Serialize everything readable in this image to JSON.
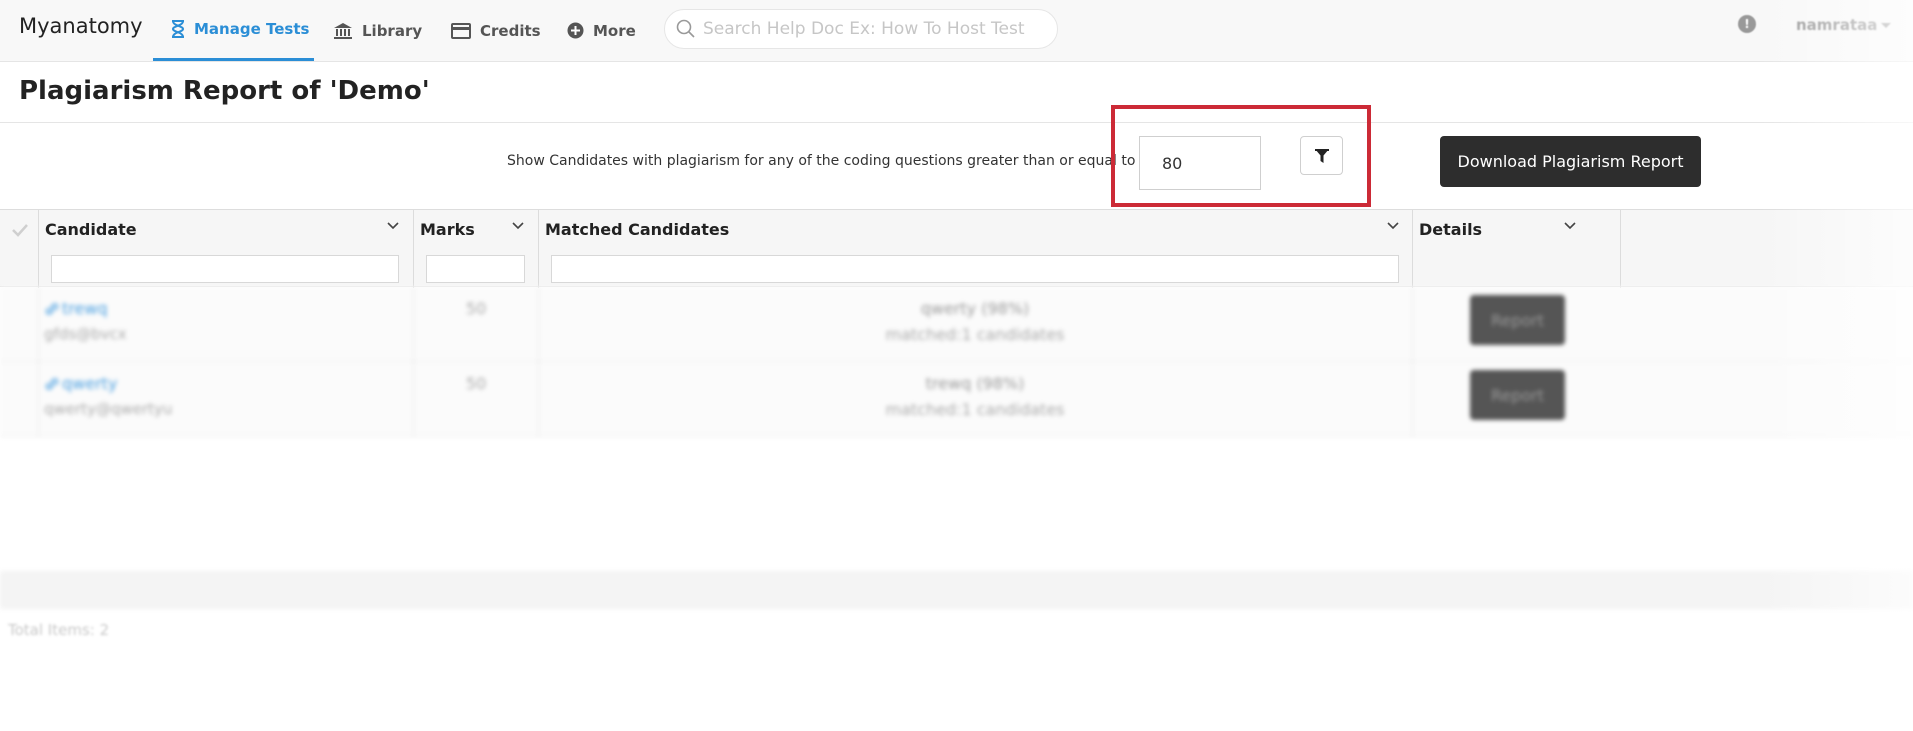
{
  "nav": {
    "brand": "Myanatomy",
    "items": [
      {
        "label": "Manage Tests",
        "icon": "hourglass-icon",
        "active": true
      },
      {
        "label": "Library",
        "icon": "bank-icon"
      },
      {
        "label": "Credits",
        "icon": "credit-card-icon"
      },
      {
        "label": "More",
        "icon": "plus-circle-icon"
      }
    ],
    "search_placeholder": "Search Help Doc Ex: How To Host Test",
    "info_glyph": "!",
    "username": "namrataa"
  },
  "page": {
    "title": "Plagiarism Report of 'Demo'"
  },
  "filter": {
    "label": "Show Candidates with plagiarism for any of the coding questions greater than or equal to :",
    "threshold_value": "80",
    "download_label": "Download Plagiarism Report",
    "highlight_color": "#cc2a36"
  },
  "grid": {
    "columns": [
      "Candidate",
      "Marks",
      "Matched Candidates",
      "Details"
    ],
    "rows": [
      {
        "name": "trewq",
        "email": "gfds@bvcx",
        "marks": "50",
        "match": "qwerty (98%)",
        "matched_count": "matched:1 candidates",
        "details": "Report"
      },
      {
        "name": "qwerty",
        "email": "qwerty@qwertyu",
        "marks": "50",
        "match": "trewq (98%)",
        "matched_count": "matched:1 candidates",
        "details": "Report"
      }
    ],
    "total_items": "Total Items: 2"
  },
  "colors": {
    "accent": "#2b8ed6",
    "dark_button": "#2d2d2d"
  }
}
